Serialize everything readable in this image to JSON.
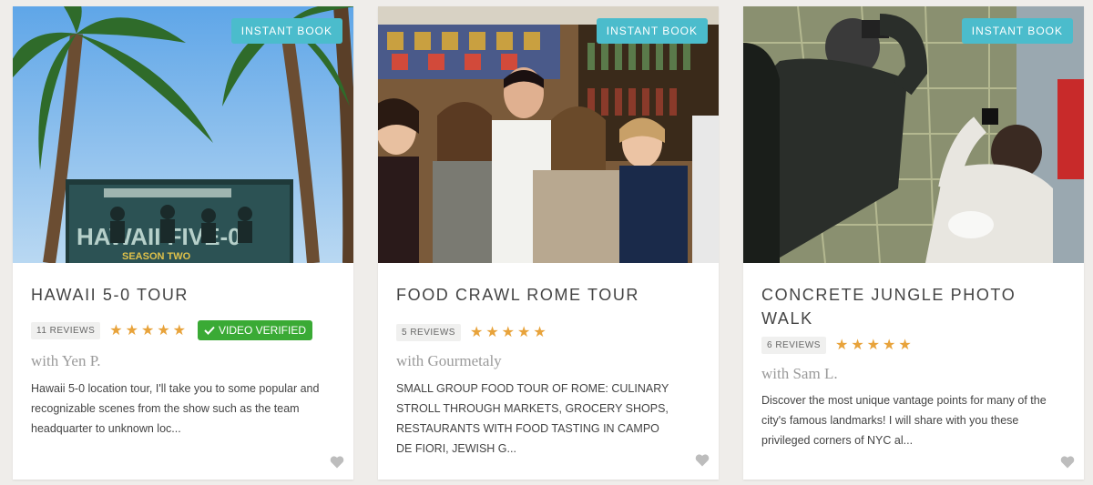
{
  "cards": [
    {
      "badge": "INSTANT BOOK",
      "title": "HAWAII 5-0 TOUR",
      "reviews": "11 REVIEWS",
      "stars": "★★★★★",
      "video_badge": "VIDEO VERIFIED",
      "host": "with Yen P.",
      "description": "Hawaii 5-0 location tour, I'll take you to some popular and recognizable scenes from the show such as the team headquarter to unknown loc..."
    },
    {
      "badge": "INSTANT BOOK",
      "title": "FOOD CRAWL ROME TOUR",
      "reviews": "5 REVIEWS",
      "stars": "★★★★★",
      "host": "with Gourmetaly",
      "description": "SMALL GROUP FOOD TOUR OF ROME: CULINARY STROLL THROUGH MARKETS, GROCERY SHOPS, RESTAURANTS WITH FOOD TASTING IN CAMPO DE FIORI, JEWISH G..."
    },
    {
      "badge": "INSTANT BOOK",
      "title": "CONCRETE JUNGLE PHOTO WALK",
      "reviews": "6 REVIEWS",
      "stars": "★★★★★",
      "host": "with Sam L.",
      "description": "Discover the most unique vantage points for many of the city's famous landmarks! I will share with you these privileged corners of NYC al..."
    }
  ],
  "colors": {
    "instant_badge": "#4bbccc",
    "video_badge": "#3aaa35",
    "stars": "#e8a33b",
    "heart": "#bdbdbd"
  },
  "icons": {
    "heart": "heart-icon",
    "check": "check-icon",
    "star": "star-icon"
  }
}
